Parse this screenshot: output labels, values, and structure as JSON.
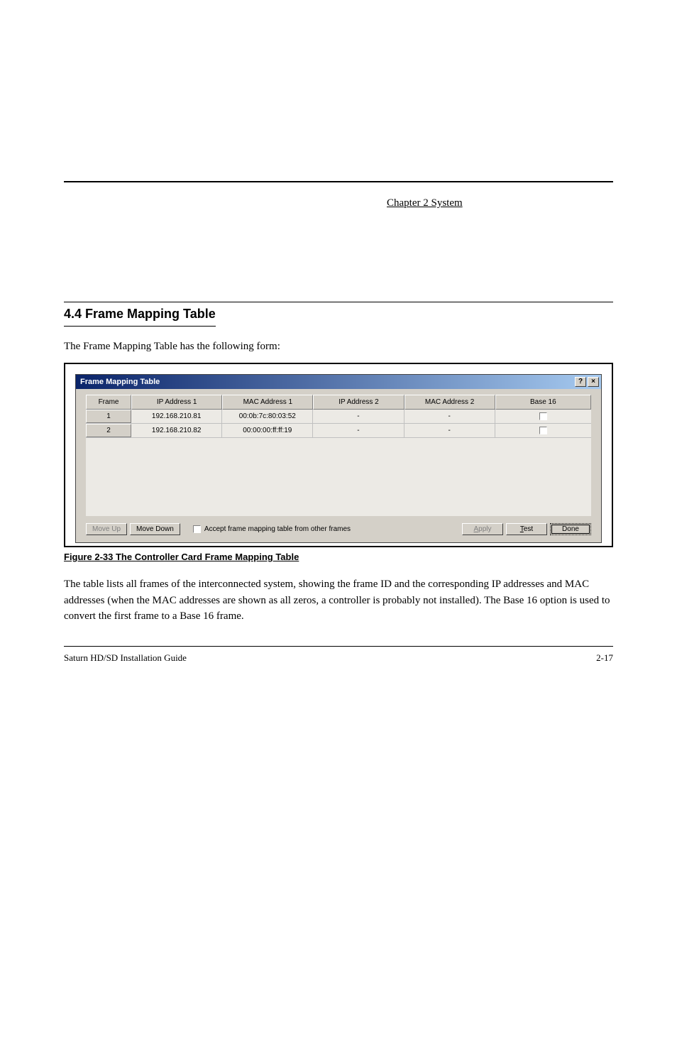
{
  "header": {
    "chapter_link": "Chapter 2 System"
  },
  "section": {
    "title": "4.4 Frame Mapping Table",
    "intro": "The Frame Mapping Table has the following form:"
  },
  "dialog": {
    "title": "Frame Mapping Table",
    "help_icon": "?",
    "close_icon": "×",
    "columns": {
      "frame": "Frame",
      "ip1": "IP Address 1",
      "mac1": "MAC Address 1",
      "ip2": "IP Address 2",
      "mac2": "MAC Address 2",
      "base16": "Base 16"
    },
    "rows": [
      {
        "frame": "1",
        "ip1": "192.168.210.81",
        "mac1": "00:0b:7c:80:03:52",
        "ip2": "-",
        "mac2": "-",
        "base16": false
      },
      {
        "frame": "2",
        "ip1": "192.168.210.82",
        "mac1": "00:00:00:ff:ff:19",
        "ip2": "-",
        "mac2": "-",
        "base16": false
      }
    ],
    "buttons": {
      "move_up": "Move Up",
      "move_down": "Move Down",
      "accept_label": "Accept frame mapping table from other frames",
      "apply": "Apply",
      "test": "Test",
      "done": "Done"
    }
  },
  "figure_caption": "Figure 2-33 The Controller Card Frame Mapping Table",
  "body_paragraph": "The table lists all frames of the interconnected system, showing the frame ID and the corresponding IP addresses and MAC addresses (when the MAC addresses are shown as all zeros, a controller is probably not installed). The Base 16 option is used to convert the first frame to a Base 16 frame.",
  "footer": {
    "left": "Saturn HD/SD Installation Guide",
    "right": "2-17"
  }
}
